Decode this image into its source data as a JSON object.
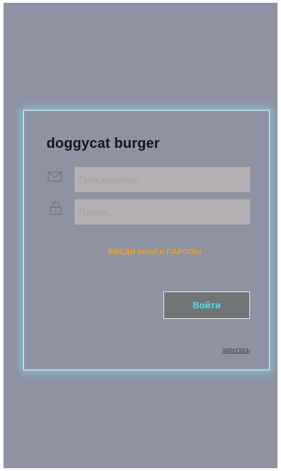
{
  "login_card": {
    "title": "doggycat burger",
    "username_placeholder": "Пользователь",
    "password_placeholder": "Пароль",
    "error_message": "ВВЕДИ email и ПАРОЛЬ!",
    "login_button_label": "Войти",
    "register_link_label": "зарегись"
  },
  "icons": {
    "username": "mail-icon",
    "password": "lock-icon"
  },
  "colors": {
    "screen_background": "#8f92a3",
    "card_glow": "#78e1eb",
    "field_background": "#b5b0b3",
    "error_text": "#f2a11a",
    "button_background": "#727577",
    "button_text": "#44e6f0"
  }
}
